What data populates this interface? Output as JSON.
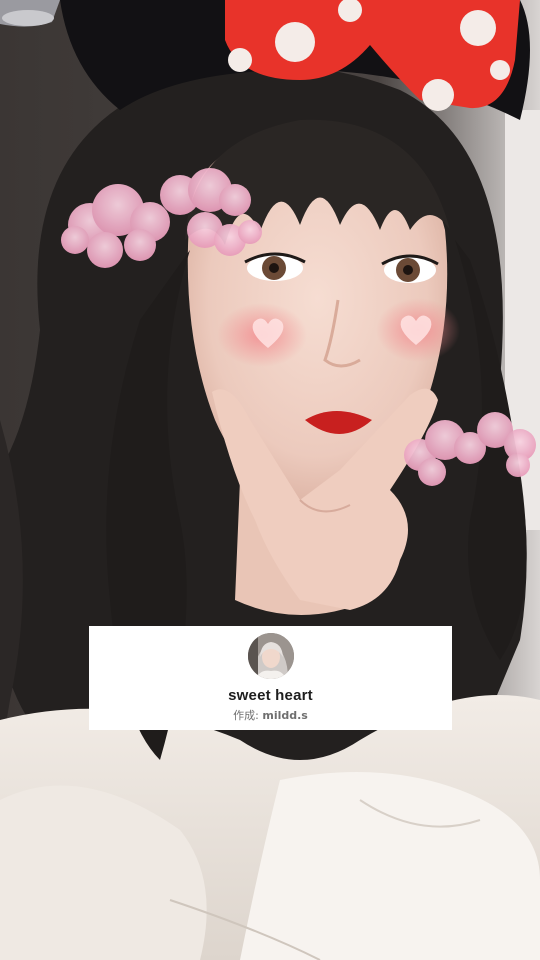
{
  "effect": {
    "title": "sweet heart",
    "creator_prefix": "作成: ",
    "creator_name": "mildd.s",
    "avatar_icon": "creator-avatar"
  },
  "colors": {
    "card_background": "#ffffff",
    "title_color": "#1e1e1e",
    "creator_color": "#6f6f6f",
    "bow_red": "#e8332a",
    "cloud_pink": "#f2b8cf"
  }
}
